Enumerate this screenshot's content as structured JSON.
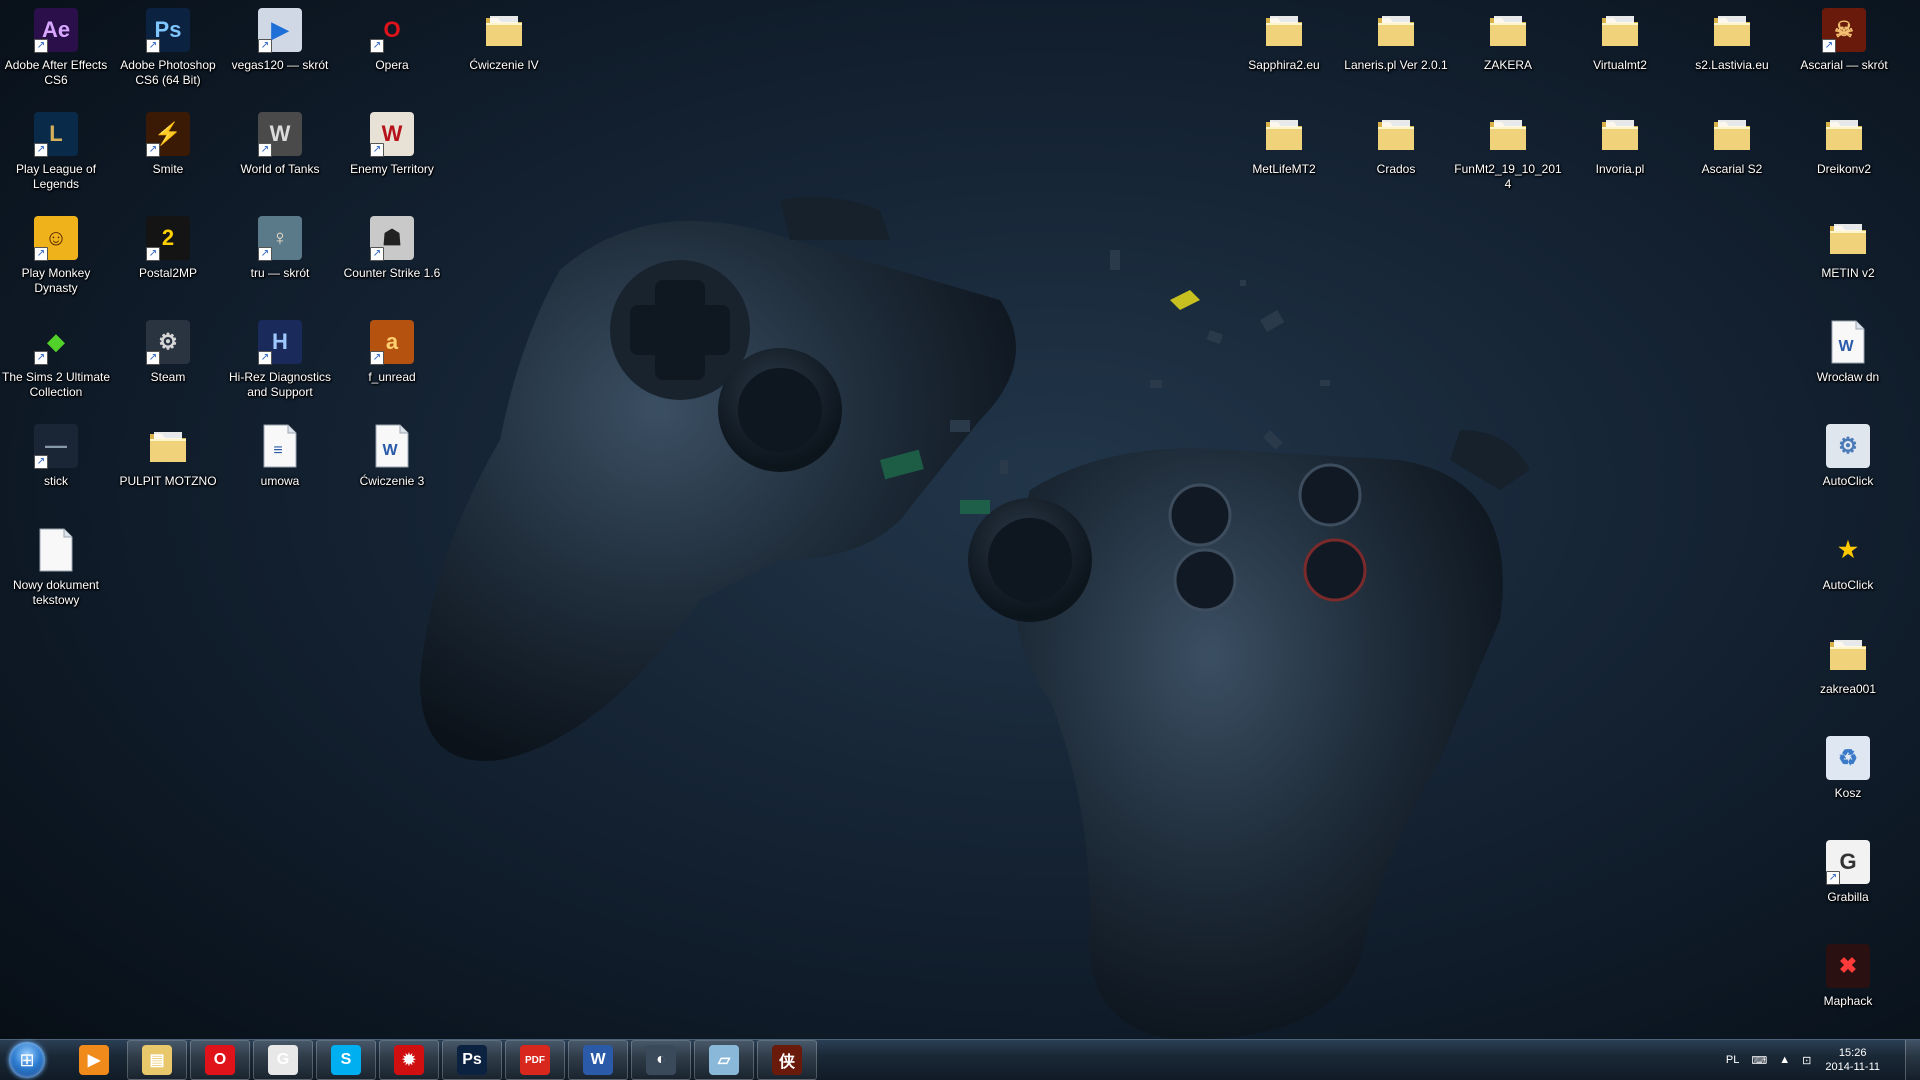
{
  "desktop": {
    "left_icons": [
      {
        "label": "Adobe After Effects CS6",
        "icon": "after-effects-icon",
        "color": "#2a0f4a",
        "glyph": "Ae",
        "fg": "#d9a6ff"
      },
      {
        "label": "Adobe Photoshop CS6 (64 Bit)",
        "icon": "photoshop-icon",
        "color": "#0b2240",
        "glyph": "Ps",
        "fg": "#7fc6ff"
      },
      {
        "label": "vegas120 — skrót",
        "icon": "vegas-icon",
        "color": "#cfd8e4",
        "glyph": "▶",
        "fg": "#1f6fd8"
      },
      {
        "label": "Opera",
        "icon": "opera-icon",
        "color": "transparent",
        "glyph": "O",
        "fg": "#e0131b"
      },
      {
        "label": "Ćwiczenie IV",
        "icon": "folder-icon",
        "color": "#e8c86a",
        "glyph": "",
        "fg": "#fff"
      },
      {
        "label": "Play League of Legends",
        "icon": "league-of-legends-icon",
        "color": "#0a2a4a",
        "glyph": "L",
        "fg": "#d6b15a"
      },
      {
        "label": "Smite",
        "icon": "smite-icon",
        "color": "#3a1a05",
        "glyph": "⚡",
        "fg": "#ffb400"
      },
      {
        "label": "World of Tanks",
        "icon": "world-of-tanks-icon",
        "color": "#4a4a4a",
        "glyph": "W",
        "fg": "#dcdcdc"
      },
      {
        "label": "Enemy Territory",
        "icon": "enemy-territory-icon",
        "color": "#e8e2d6",
        "glyph": "W",
        "fg": "#b5121b"
      },
      {
        "label": "Play Monkey Dynasty",
        "icon": "monkey-dynasty-icon",
        "color": "#f0b21a",
        "glyph": "☺",
        "fg": "#5a2a00"
      },
      {
        "label": "Postal2MP",
        "icon": "postal2-icon",
        "color": "#141414",
        "glyph": "2",
        "fg": "#ffd000"
      },
      {
        "label": "tru — skrót",
        "icon": "tomb-raider-icon",
        "color": "#5a7a8a",
        "glyph": "♀",
        "fg": "#f2e0c8"
      },
      {
        "label": "Counter Strike 1.6",
        "icon": "counter-strike-icon",
        "color": "#c9c9c9",
        "glyph": "☗",
        "fg": "#222"
      },
      {
        "label": "The Sims 2 Ultimate Collection",
        "icon": "sims-icon",
        "color": "transparent",
        "glyph": "◆",
        "fg": "#52d12a"
      },
      {
        "label": "Steam",
        "icon": "steam-icon",
        "color": "#2a3340",
        "glyph": "⚙",
        "fg": "#d6d6d6"
      },
      {
        "label": "Hi-Rez Diagnostics and Support",
        "icon": "hirez-icon",
        "color": "#1a2a5a",
        "glyph": "H",
        "fg": "#9fc8ff"
      },
      {
        "label": "f_unread",
        "icon": "f-unread-icon",
        "color": "#b5520f",
        "glyph": "a",
        "fg": "#ffd070"
      },
      {
        "label": "stick",
        "icon": "stick-icon",
        "color": "#1a2636",
        "glyph": "—",
        "fg": "#8899aa"
      },
      {
        "label": "PULPIT MOTZNO",
        "icon": "folder-icon",
        "color": "#e8c86a",
        "glyph": "",
        "fg": "#fff"
      },
      {
        "label": "umowa",
        "icon": "word-document-icon",
        "color": "#f4f6fb",
        "glyph": "≡",
        "fg": "#2b5aa8"
      },
      {
        "label": "Ćwiczenie 3",
        "icon": "word-document-icon",
        "color": "#f4f6fb",
        "glyph": "W",
        "fg": "#2b5aa8"
      },
      {
        "label": "Nowy dokument tekstowy",
        "icon": "text-document-icon",
        "color": "#f8f8f8",
        "glyph": "",
        "fg": "#999"
      }
    ],
    "right_icons": [
      {
        "label": "Sapphira2.eu",
        "icon": "folder-icon"
      },
      {
        "label": "Laneris.pl Ver 2.0.1",
        "icon": "folder-icon"
      },
      {
        "label": "ZAKERA",
        "icon": "folder-icon"
      },
      {
        "label": "Virtualmt2",
        "icon": "folder-icon"
      },
      {
        "label": "s2.Lastivia.eu",
        "icon": "folder-icon"
      },
      {
        "label": "Ascarial — skrót",
        "icon": "ascarial-shortcut-icon",
        "glyph": "☠",
        "color": "#6a1a0a",
        "fg": "#f2c070"
      },
      {
        "label": "MetLifeMT2",
        "icon": "folder-icon"
      },
      {
        "label": "Crados",
        "icon": "folder-icon"
      },
      {
        "label": "FunMt2_19_10_2014",
        "icon": "folder-icon"
      },
      {
        "label": "Invoria.pl",
        "icon": "folder-icon"
      },
      {
        "label": "Ascarial S2",
        "icon": "folder-icon"
      },
      {
        "label": "Dreikonv2",
        "icon": "folder-icon"
      },
      {
        "label": "METIN v2",
        "icon": "folder-icon"
      },
      {
        "label": "Wrocław dn",
        "icon": "word-document-icon",
        "glyph": "W",
        "color": "#f4f6fb",
        "fg": "#2b5aa8"
      },
      {
        "label": "AutoClick",
        "icon": "autoclick-gear-icon",
        "glyph": "⚙",
        "color": "#dfe6ee",
        "fg": "#4a79b8"
      },
      {
        "label": "AutoClick",
        "icon": "autoclick-star-icon",
        "glyph": "★",
        "color": "transparent",
        "fg": "#ffc800"
      },
      {
        "label": "zakrea001",
        "icon": "folder-icon"
      },
      {
        "label": "Kosz",
        "icon": "recycle-bin-icon",
        "glyph": "♻",
        "color": "#dfe8f2",
        "fg": "#3a7ac8"
      },
      {
        "label": "Grabilla",
        "icon": "grabilla-icon",
        "glyph": "G",
        "color": "#f2f2f2",
        "fg": "#333"
      },
      {
        "label": "Maphack",
        "icon": "maphack-icon",
        "glyph": "✖",
        "color": "#2a1010",
        "fg": "#ff3a3a"
      }
    ]
  },
  "taskbar": {
    "buttons": [
      {
        "name": "media-player",
        "icon": "media-player-icon",
        "glyph": "▶",
        "color": "#f08a1a",
        "pinned": false
      },
      {
        "name": "explorer",
        "icon": "explorer-folder-icon",
        "glyph": "▤",
        "color": "#e8c86a",
        "pinned": true
      },
      {
        "name": "opera",
        "icon": "opera-icon",
        "glyph": "O",
        "color": "#e0131b",
        "pinned": true
      },
      {
        "name": "grabilla",
        "icon": "grabilla-icon",
        "glyph": "G",
        "color": "#e8e8e8",
        "pinned": true
      },
      {
        "name": "skype",
        "icon": "skype-icon",
        "glyph": "S",
        "color": "#00aff0",
        "pinned": true
      },
      {
        "name": "antivirus",
        "icon": "red-bug-icon",
        "glyph": "✹",
        "color": "#d01010",
        "pinned": true
      },
      {
        "name": "photoshop",
        "icon": "photoshop-icon",
        "glyph": "Ps",
        "color": "#0b2240",
        "pinned": true
      },
      {
        "name": "pdf-viewer",
        "icon": "pdf-icon",
        "glyph": "PDF",
        "color": "#d8281e",
        "pinned": true
      },
      {
        "name": "word",
        "icon": "word-icon",
        "glyph": "W",
        "color": "#2b5aa8",
        "pinned": true
      },
      {
        "name": "steam",
        "icon": "steam-icon",
        "glyph": "◐",
        "color": "#3a4a5a",
        "pinned": true
      },
      {
        "name": "paint",
        "icon": "paint-icon",
        "glyph": "▱",
        "color": "#8ab8d8",
        "pinned": true
      },
      {
        "name": "metin",
        "icon": "metin-game-icon",
        "glyph": "侠",
        "color": "#6a1a0a",
        "pinned": true
      }
    ],
    "tray": {
      "language": "PL",
      "clock_time": "15:26",
      "clock_date": "2014-11-11"
    }
  }
}
